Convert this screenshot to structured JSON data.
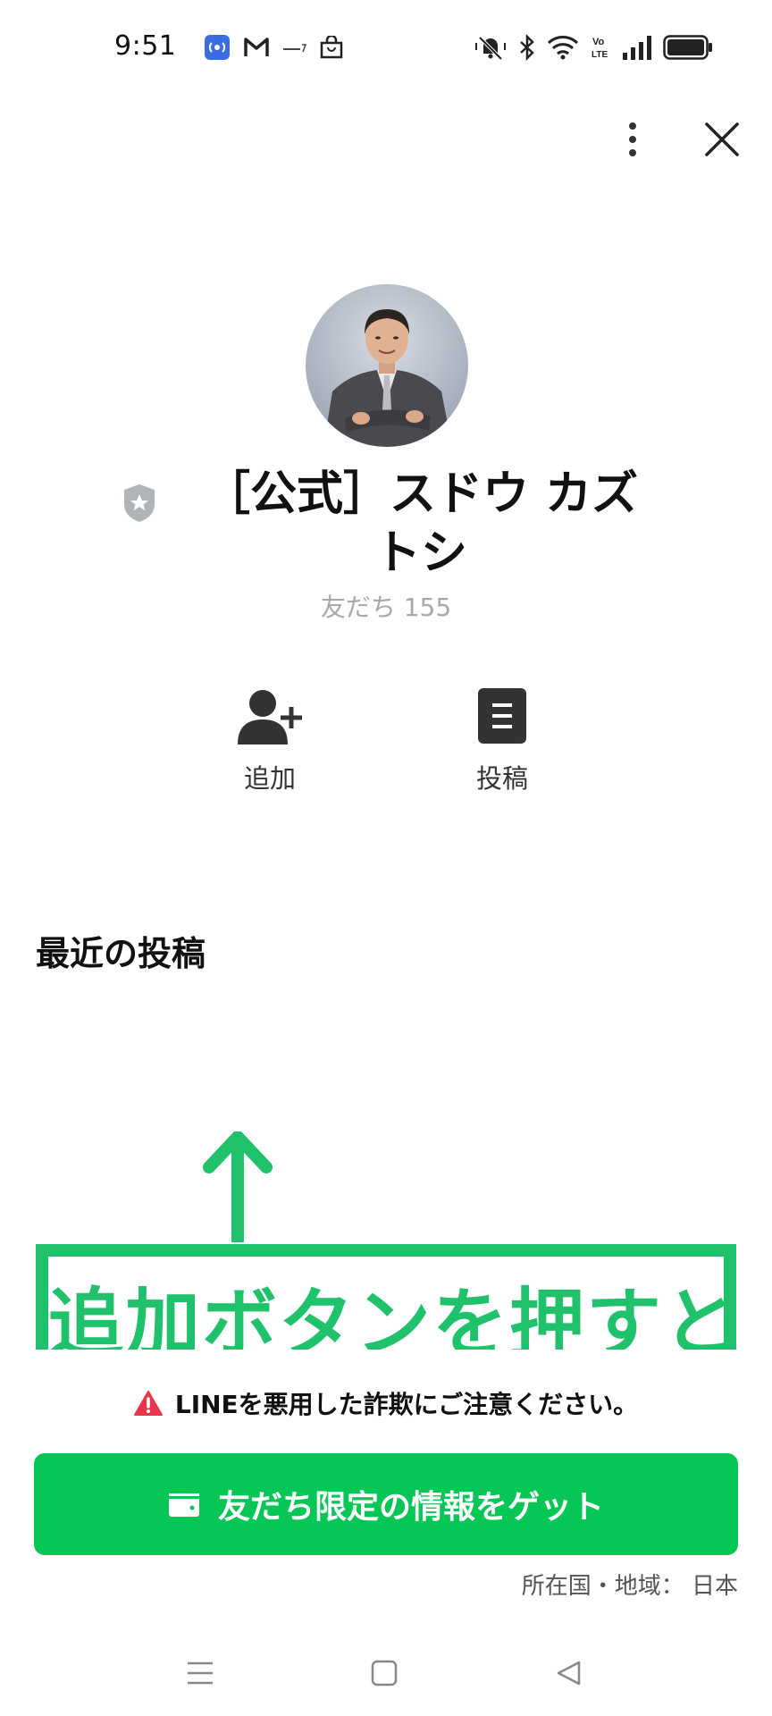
{
  "status_bar": {
    "time": "9:51",
    "left_icons": [
      "nfc-icon",
      "gmail-icon",
      "carrier-logo-icon",
      "shopping-bag-icon"
    ],
    "right_icons": [
      "mute-icon",
      "bluetooth-icon",
      "wifi-icon",
      "volte-icon",
      "signal-icon",
      "battery-icon"
    ]
  },
  "header": {
    "more_icon": "more-vertical-icon",
    "close_icon": "close-icon"
  },
  "profile": {
    "name": "［公式］スドウ カズトシ",
    "badge_icon": "official-badge-icon",
    "friends_text": "友だち 155"
  },
  "actions": [
    {
      "label": "追加",
      "icon": "add-friend-icon"
    },
    {
      "label": "投稿",
      "icon": "posts-icon"
    }
  ],
  "recent_posts": {
    "title": "最近の投稿",
    "post_text": "追加ボタンを押すと"
  },
  "footer": {
    "warning": "LINEを悪用した詐欺にご注意ください。",
    "cta_label": "友だち限定の情報をゲット",
    "region": "所在国・地域： 日本"
  },
  "colors": {
    "line_green": "#06c755",
    "post_green": "#1fc26a",
    "warning_red": "#e8374a"
  }
}
